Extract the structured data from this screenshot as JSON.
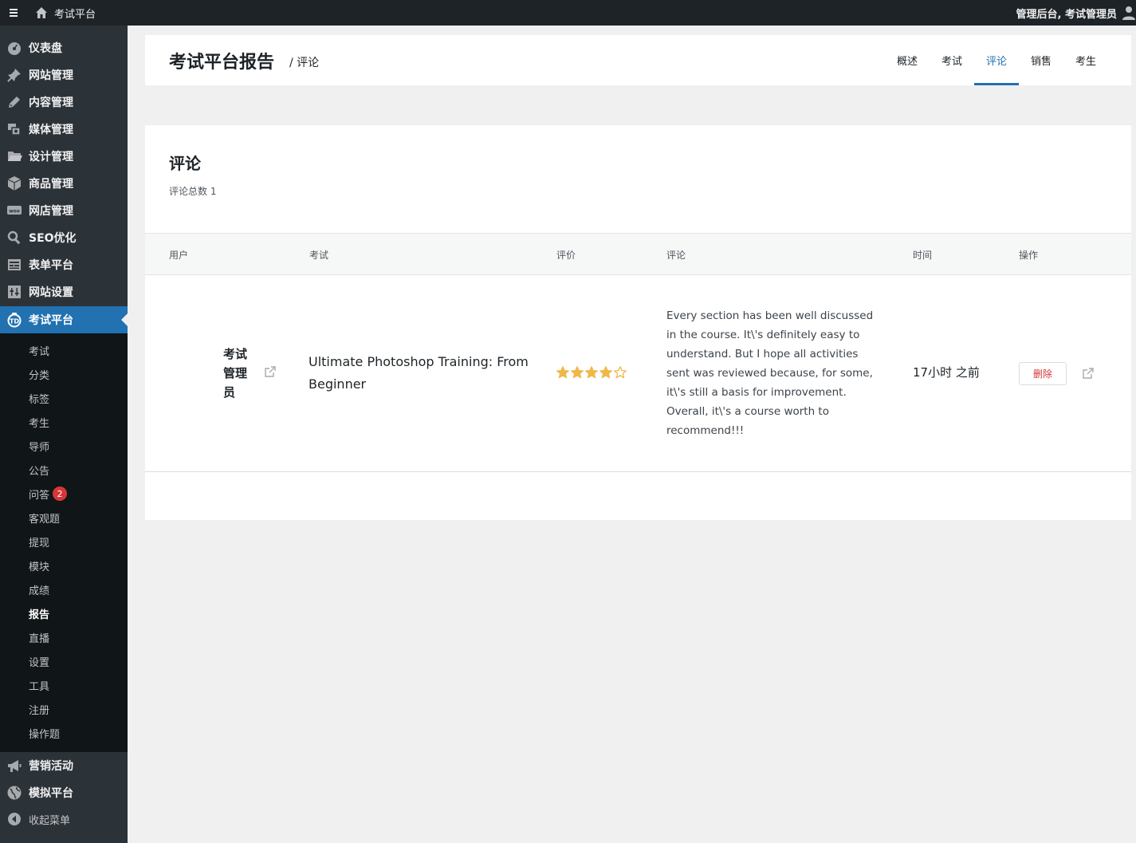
{
  "adminbar": {
    "site_name": "考试平台",
    "account_label": "管理后台, 考试管理员",
    "icons": [
      "menu-icon",
      "home-icon",
      "user-icon"
    ]
  },
  "sidebar": {
    "items": [
      {
        "label": "仪表盘",
        "icon": "dashboard-icon"
      },
      {
        "label": "网站管理",
        "icon": "pin-icon"
      },
      {
        "label": "内容管理",
        "icon": "pencil-icon"
      },
      {
        "label": "媒体管理",
        "icon": "media-icon"
      },
      {
        "label": "设计管理",
        "icon": "folder-icon"
      },
      {
        "label": "商品管理",
        "icon": "box-icon"
      },
      {
        "label": "网店管理",
        "icon": "woo-icon"
      },
      {
        "label": "SEO优化",
        "icon": "search-icon"
      },
      {
        "label": "表单平台",
        "icon": "form-icon"
      },
      {
        "label": "网站设置",
        "icon": "settings-icon"
      },
      {
        "label": "考试平台",
        "icon": "exam-icon",
        "active": true
      }
    ],
    "submenu": [
      {
        "label": "考试"
      },
      {
        "label": "分类"
      },
      {
        "label": "标签"
      },
      {
        "label": "考生"
      },
      {
        "label": "导师"
      },
      {
        "label": "公告"
      },
      {
        "label": "问答",
        "badge": "2"
      },
      {
        "label": "客观题"
      },
      {
        "label": "提现"
      },
      {
        "label": "模块"
      },
      {
        "label": "成绩"
      },
      {
        "label": "报告",
        "current": true
      },
      {
        "label": "直播"
      },
      {
        "label": "设置"
      },
      {
        "label": "工具"
      },
      {
        "label": "注册"
      },
      {
        "label": "操作题"
      }
    ],
    "bottom_items": [
      {
        "label": "营销活动",
        "icon": "megaphone-icon"
      },
      {
        "label": "模拟平台",
        "icon": "globe-icon"
      }
    ],
    "collapse_label": "收起菜单"
  },
  "header": {
    "title": "考试平台报告",
    "crumb": "/ 评论",
    "tabs": [
      {
        "label": "概述"
      },
      {
        "label": "考试"
      },
      {
        "label": "评论",
        "active": true
      },
      {
        "label": "销售"
      },
      {
        "label": "考生"
      }
    ]
  },
  "card": {
    "title": "评论",
    "count_label": "评论总数 1",
    "columns": [
      "用户",
      "考试",
      "评价",
      "评论",
      "时间",
      "操作"
    ],
    "rows": [
      {
        "user": "考试管理员",
        "exam": "Ultimate Photoshop Training: From Beginner",
        "rating": 4,
        "rating_max": 5,
        "comment_lines": [
          "Every section has been well discussed in the course. It\\'s definitely easy to understand. But I hope all activities sent was reviewed because, for some, it\\'s still a basis for improvement.",
          "Overall, it\\'s a course worth to recommend!!!"
        ],
        "time": "17小时 之前",
        "delete_label": "删除"
      }
    ]
  },
  "colors": {
    "accent": "#2271b1",
    "sidebar_bg": "#2c3338",
    "submenu_bg": "#101517",
    "adminbar_bg": "#1d2327",
    "star": "#f0b849",
    "danger": "#d63638"
  }
}
